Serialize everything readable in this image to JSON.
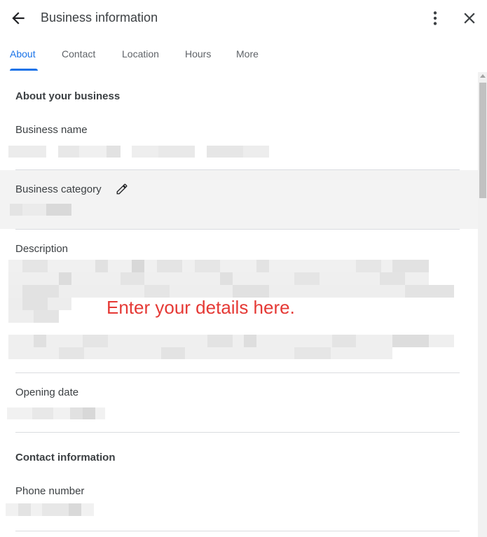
{
  "header": {
    "title": "Business information",
    "back_icon": "arrow-left-icon",
    "menu_icon": "more-vert-icon",
    "close_icon": "close-icon"
  },
  "tabs": [
    {
      "label": "About",
      "active": true
    },
    {
      "label": "Contact",
      "active": false
    },
    {
      "label": "Location",
      "active": false
    },
    {
      "label": "Hours",
      "active": false
    },
    {
      "label": "More",
      "active": false
    }
  ],
  "about_section": {
    "heading": "About your business",
    "business_name_label": "Business name",
    "business_category_label": "Business category",
    "category_edit_icon": "pencil-icon",
    "description_label": "Description",
    "opening_date_label": "Opening date"
  },
  "contact_section": {
    "heading": "Contact information",
    "phone_label": "Phone number"
  },
  "annotation": {
    "text": "Enter your details here."
  },
  "colors": {
    "accent": "#1a73e8",
    "annotation": "#e53935",
    "divider": "#dadce0"
  }
}
